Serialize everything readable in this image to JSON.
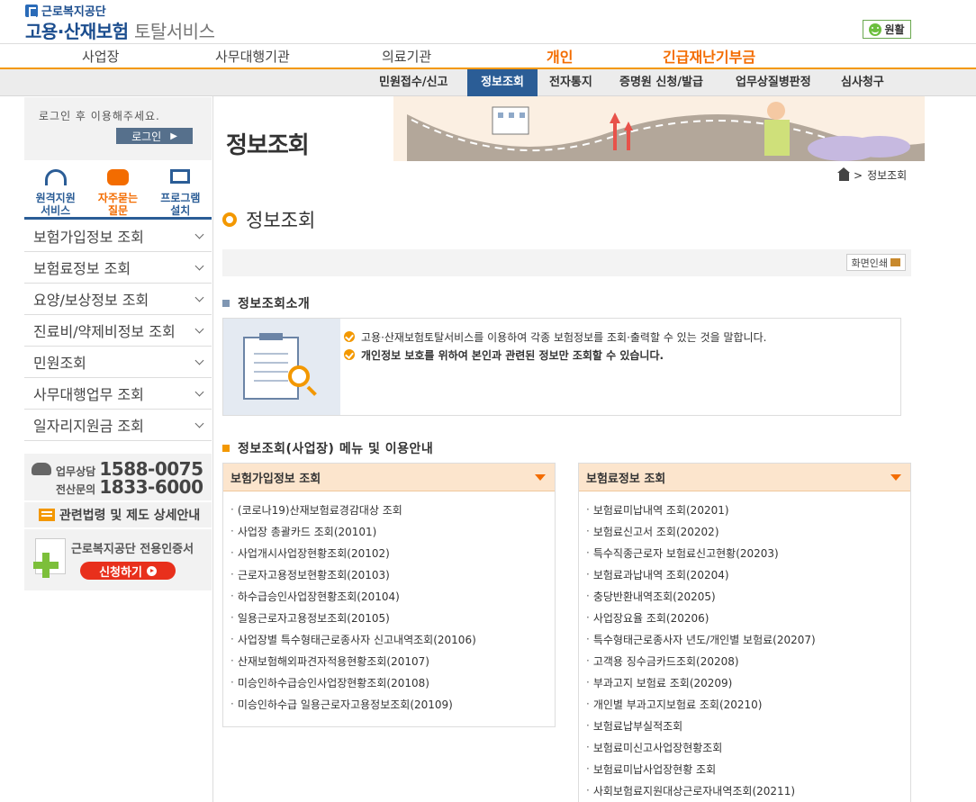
{
  "header": {
    "org_name": "근로복지공단",
    "service_title_bold": "고용·산재보험",
    "service_title_thin": "토탈서비스",
    "status_label": "원활"
  },
  "top_nav": [
    "사업장",
    "사무대행기관",
    "의료기관",
    "개인",
    "긴급재난기부금"
  ],
  "sub_nav": {
    "items": [
      "민원접수/신고",
      "정보조회",
      "전자통지",
      "증명원 신청/발급",
      "업무상질병판정",
      "심사청구"
    ],
    "active": "정보조회"
  },
  "sidebar": {
    "login_msg": "로그인 후 이용해주세요.",
    "login_btn": "로그인",
    "quick": [
      {
        "line1": "원격지원",
        "line2": "서비스"
      },
      {
        "line1": "자주묻는",
        "line2": "질문"
      },
      {
        "line1": "프로그램",
        "line2": "설치"
      }
    ],
    "menu": [
      "보험가입정보 조회",
      "보험료정보 조회",
      "요양/보상정보 조회",
      "진료비/약제비정보 조회",
      "민원조회",
      "사무대행업무 조회",
      "일자리지원금 조회"
    ],
    "phone1_label": "업무상담",
    "phone1": "1588-0075",
    "phone2_label": "전산문의",
    "phone2": "1833-6000",
    "law_label": "관련법령 및 제도 상세안내",
    "cert_title": "근로복지공단 전용인증서",
    "cert_btn": "신청하기"
  },
  "main": {
    "banner_title": "정보조회",
    "breadcrumb": "정보조회",
    "page_title": "정보조회",
    "print_btn": "화면인쇄",
    "intro_heading": "정보조회소개",
    "intro_lines": [
      "고용·산재보험토탈서비스를 이용하여 각종 보험정보를 조회·출력할 수 있는 것을 말합니다.",
      "개인정보 보호를 위하여 본인과 관련된 정보만 조회할 수 있습니다."
    ],
    "menu_heading": "정보조회(사업장) 메뉴 및 이용안내",
    "left_box": {
      "title": "보험가입정보 조회",
      "items": [
        "(코로나19)산재보험료경감대상 조회",
        "사업장 총괄카드 조회(20101)",
        "사업개시사업장현황조회(20102)",
        "근로자고용정보현황조회(20103)",
        "하수급승인사업장현황조회(20104)",
        "일용근로자고용정보조회(20105)",
        "사업장별 특수형태근로종사자 신고내역조회(20106)",
        "산재보험해외파견자적용현황조회(20107)",
        "미승인하수급승인사업장현황조회(20108)",
        "미승인하수급 일용근로자고용정보조회(20109)"
      ]
    },
    "right_box": {
      "title": "보험료정보 조회",
      "items": [
        "보험료미납내역 조회(20201)",
        "보험료신고서 조회(20202)",
        "특수직종근로자 보험료신고현황(20203)",
        "보험료과납내역 조회(20204)",
        "충당반환내역조회(20205)",
        "사업장요율 조회(20206)",
        "특수형태근로종사자 년도/개인별 보험료(20207)",
        "고객용 징수금카드조회(20208)",
        "부과고지 보험료 조회(20209)",
        "개인별 부과고지보험료 조회(20210)",
        "보험료납부실적조회",
        "보험료미신고사업장현황조회",
        "보험료미납사업장현황 조회",
        "사회보험료지원대상근로자내역조회(20211)"
      ]
    }
  }
}
